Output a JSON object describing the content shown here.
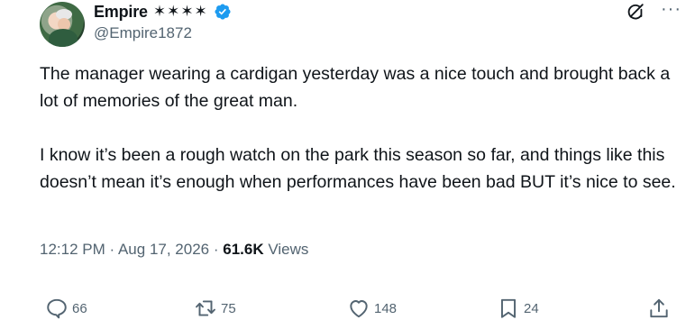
{
  "author": {
    "display_name": "Empire",
    "decoration": "✶✶✶✶",
    "handle": "@Empire1872"
  },
  "tweet": {
    "paragraphs": [
      "The manager wearing a cardigan yesterday was a nice touch and brought back a lot of memories of the great man.",
      "I know it’s been a rough watch on the park this season so far, and things like this doesn’t mean it’s enough when performances have been bad BUT it’s nice to see."
    ],
    "time": "12:12 PM",
    "date": "Aug 17, 2026",
    "views_count": "61.6K",
    "views_label": "Views",
    "separator": "·"
  },
  "actions": {
    "replies": "66",
    "reposts": "75",
    "likes": "148",
    "bookmarks": "24"
  },
  "colors": {
    "verified": "#1d9bf0",
    "secondary_text": "#536471",
    "primary_text": "#0f1419"
  },
  "icons": [
    "verified-badge-icon",
    "grok-icon",
    "more-icon",
    "reply-icon",
    "repost-icon",
    "like-icon",
    "bookmark-icon",
    "share-icon"
  ]
}
